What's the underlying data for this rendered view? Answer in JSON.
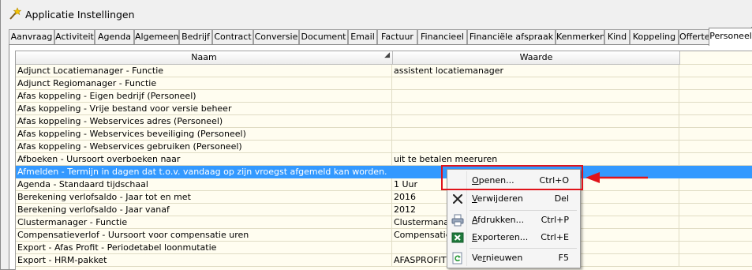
{
  "window": {
    "title": "Applicatie Instellingen"
  },
  "tabs": [
    {
      "label": "Aanvraag"
    },
    {
      "label": "Activiteit"
    },
    {
      "label": "Agenda"
    },
    {
      "label": "Algemeen"
    },
    {
      "label": "Bedrijf"
    },
    {
      "label": "Contract"
    },
    {
      "label": "Conversie"
    },
    {
      "label": "Document"
    },
    {
      "label": "Email"
    },
    {
      "label": "Factuur"
    },
    {
      "label": "Financieel"
    },
    {
      "label": "Financiële afspraak"
    },
    {
      "label": "Kenmerken"
    },
    {
      "label": "Kind"
    },
    {
      "label": "Koppeling"
    },
    {
      "label": "Offerte"
    },
    {
      "label": "Personeel"
    }
  ],
  "active_tab": "Personeel",
  "grid": {
    "columns": [
      {
        "label": "Naam"
      },
      {
        "label": "Waarde"
      }
    ],
    "sorted_column": "Naam",
    "rows": [
      {
        "name": "Adjunct Locatiemanager - Functie",
        "value": "assistent locatiemanager"
      },
      {
        "name": "Adjunct Regiomanager - Functie",
        "value": ""
      },
      {
        "name": "Afas koppeling - Eigen bedrijf (Personeel)",
        "value": ""
      },
      {
        "name": "Afas koppeling - Vrije bestand voor versie beheer",
        "value": ""
      },
      {
        "name": "Afas koppeling - Webservices adres (Personeel)",
        "value": ""
      },
      {
        "name": "Afas koppeling - Webservices beveiliging (Personeel)",
        "value": ""
      },
      {
        "name": "Afas koppeling - Webservices gebruiken (Personeel)",
        "value": ""
      },
      {
        "name": "Afboeken - Uursoort overboeken naar",
        "value": "uit te betalen meeruren"
      },
      {
        "name": "Afmelden - Termijn in dagen dat t.o.v. vandaag op zijn vroegst afgemeld kan worden.",
        "value": ""
      },
      {
        "name": "Agenda - Standaard tijdschaal",
        "value": "1 Uur"
      },
      {
        "name": "Berekening verlofsaldo - Jaar tot en met",
        "value": "2016"
      },
      {
        "name": "Berekening verlofsaldo - Jaar vanaf",
        "value": "2012"
      },
      {
        "name": "Clustermanager - Functie",
        "value": "Clustermanage"
      },
      {
        "name": "Compensatieverlof - Uursoort voor compensatie uren",
        "value": "Compensatieur"
      },
      {
        "name": "Export - Afas Profit - Periodetabel loonmutatie",
        "value": ""
      },
      {
        "name": "Export - HRM-pakket",
        "value": "AFASPROFIT"
      }
    ],
    "selected_row": 8
  },
  "context_menu": {
    "items": [
      {
        "pre": "",
        "acc": "O",
        "post": "penen...",
        "shortcut": "Ctrl+O",
        "icon": "open-icon"
      },
      {
        "pre": "",
        "acc": "V",
        "post": "erwijderen",
        "shortcut": "Del",
        "icon": "delete-x-icon"
      },
      {
        "pre": "",
        "acc": "A",
        "post": "fdrukken...",
        "shortcut": "Ctrl+P",
        "icon": "printer-icon"
      },
      {
        "pre": "",
        "acc": "E",
        "post": "xporteren...",
        "shortcut": "Ctrl+E",
        "icon": "excel-icon"
      },
      {
        "pre": "Ve",
        "acc": "r",
        "post": "nieuwen",
        "shortcut": "F5",
        "icon": "refresh-icon"
      }
    ]
  },
  "colors": {
    "selection": "#3399ff",
    "grid_background": "#fffdf0",
    "highlight_annotation": "#e0131a"
  }
}
